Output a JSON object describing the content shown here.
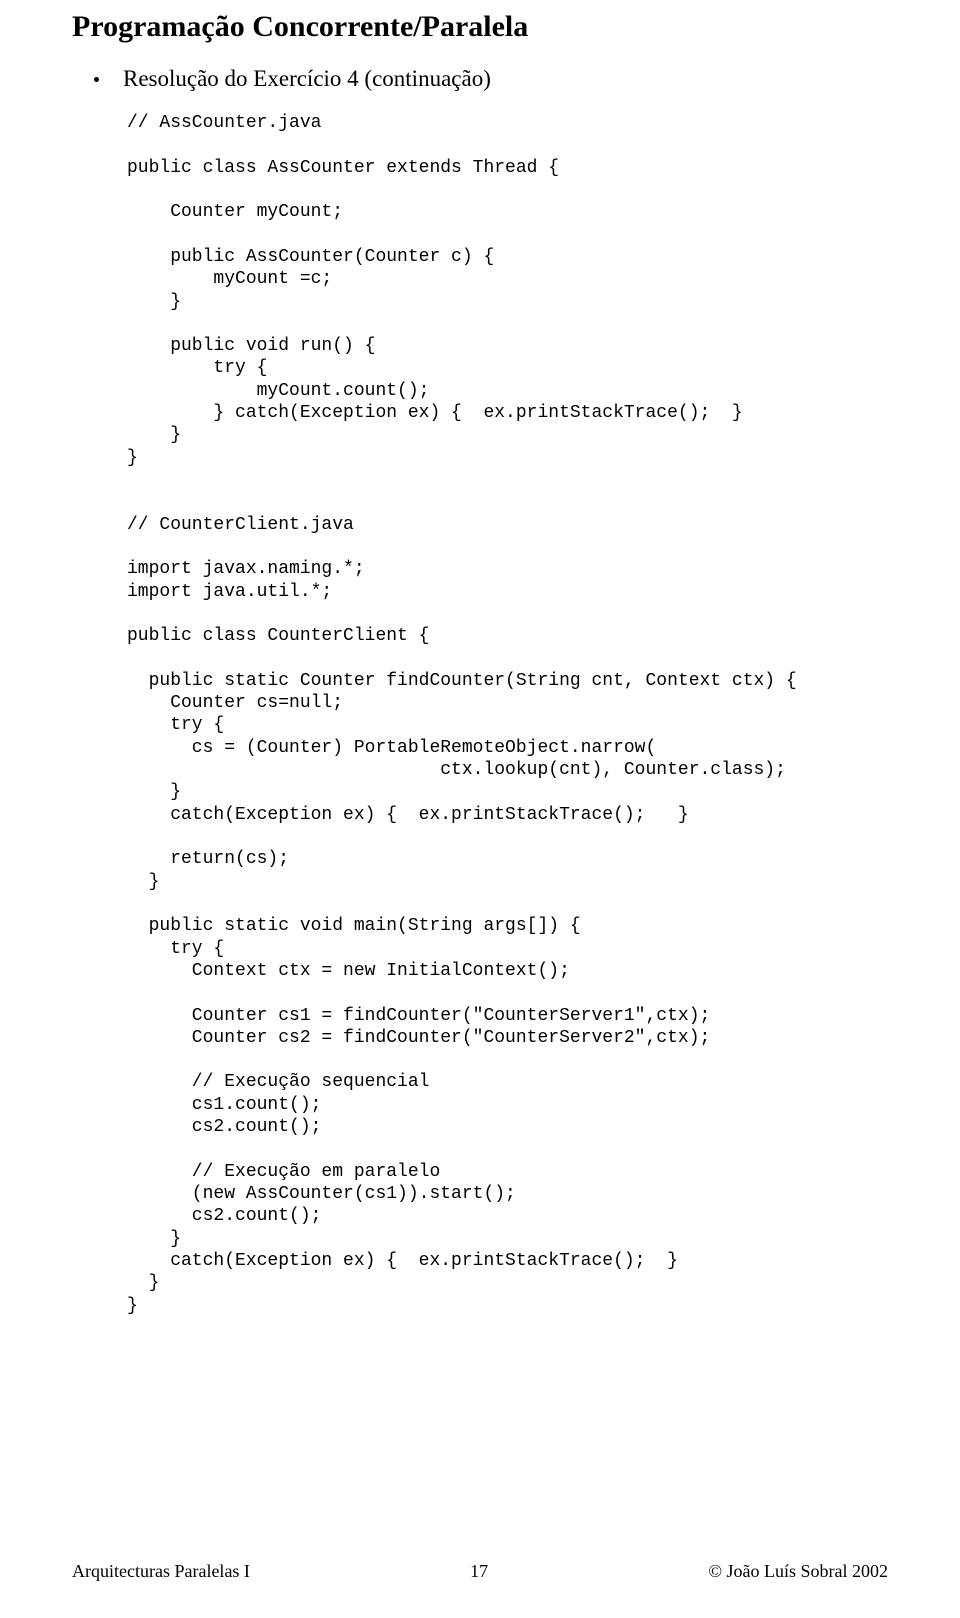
{
  "title": "Programação Concorrente/Paralela",
  "bullet": "Resolução do Exercício 4 (continuação)",
  "code": "// AssCounter.java\n\npublic class AssCounter extends Thread {\n\n    Counter myCount;\n\n    public AssCounter(Counter c) {\n        myCount =c;\n    }\n\n    public void run() {\n        try {\n            myCount.count();\n        } catch(Exception ex) {  ex.printStackTrace();  }\n    }\n}\n\n\n// CounterClient.java\n\nimport javax.naming.*;\nimport java.util.*;\n\npublic class CounterClient {\n\n  public static Counter findCounter(String cnt, Context ctx) {\n    Counter cs=null;\n    try {\n      cs = (Counter) PortableRemoteObject.narrow(\n                             ctx.lookup(cnt), Counter.class);\n    }\n    catch(Exception ex) {  ex.printStackTrace();   }\n\n    return(cs);\n  }\n\n  public static void main(String args[]) {\n    try {\n      Context ctx = new InitialContext();\n\n      Counter cs1 = findCounter(\"CounterServer1\",ctx);\n      Counter cs2 = findCounter(\"CounterServer2\",ctx);\n\n      // Execução sequencial\n      cs1.count();\n      cs2.count();\n\n      // Execução em paralelo\n      (new AssCounter(cs1)).start();\n      cs2.count();\n    }\n    catch(Exception ex) {  ex.printStackTrace();  }\n  }\n}",
  "footer": {
    "left": "Arquitecturas Paralelas I",
    "center": "17",
    "right": "© João Luís Sobral 2002"
  }
}
